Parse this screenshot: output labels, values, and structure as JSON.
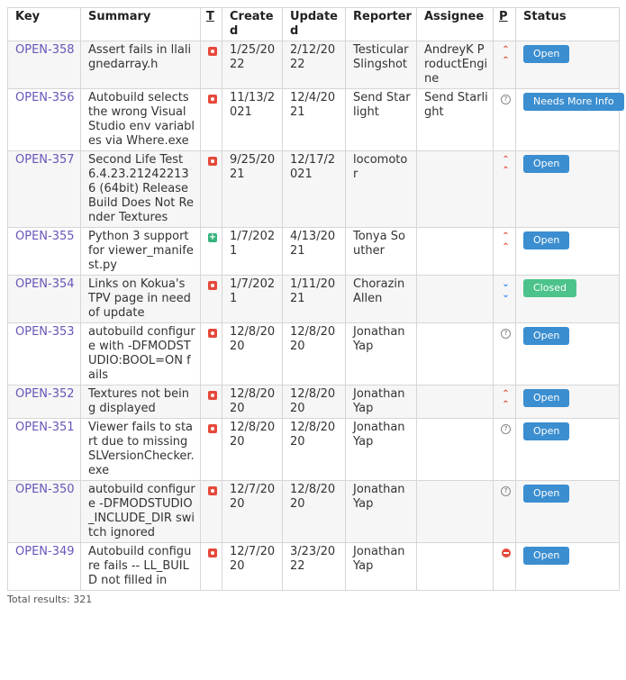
{
  "table": {
    "headers": {
      "key": "Key",
      "summary": "Summary",
      "type": "T",
      "created": "Created",
      "updated": "Updated",
      "reporter": "Reporter",
      "assignee": "Assignee",
      "priority": "P",
      "status": "Status"
    },
    "rows": [
      {
        "key": "OPEN-358",
        "summary": "Assert fails in llalignedarray.h",
        "type": "bug",
        "created": "1/25/2022",
        "updated": "2/12/2022",
        "reporter": "Testicular Slingshot",
        "assignee": "AndreyK ProductEngine",
        "priority": "high",
        "status": "Open"
      },
      {
        "key": "OPEN-356",
        "summary": "Autobuild selects the wrong Visual Studio env variables via Where.exe",
        "type": "bug",
        "created": "11/13/2021",
        "updated": "12/4/2021",
        "reporter": "Send Starlight",
        "assignee": "Send Starlight",
        "priority": "unknown",
        "status": "Needs More Info"
      },
      {
        "key": "OPEN-357",
        "summary": "Second Life Test 6.4.23.212422136 (64bit) Release Build Does Not Render Textures",
        "type": "bug",
        "created": "9/25/2021",
        "updated": "12/17/2021",
        "reporter": "locomotor",
        "assignee": "",
        "priority": "high",
        "status": "Open"
      },
      {
        "key": "OPEN-355",
        "summary": "Python 3 support for viewer_manifest.py",
        "type": "new-feature",
        "created": "1/7/2021",
        "updated": "4/13/2021",
        "reporter": "Tonya Souther",
        "assignee": "",
        "priority": "high",
        "status": "Open"
      },
      {
        "key": "OPEN-354",
        "summary": "Links on Kokua's TPV page in need of update",
        "type": "bug",
        "created": "1/7/2021",
        "updated": "1/11/2021",
        "reporter": "Chorazin Allen",
        "assignee": "",
        "priority": "lowest",
        "status": "Closed"
      },
      {
        "key": "OPEN-353",
        "summary": "autobuild configure with -DFMODSTUDIO:BOOL=ON fails",
        "type": "bug",
        "created": "12/8/2020",
        "updated": "12/8/2020",
        "reporter": "Jonathan Yap",
        "assignee": "",
        "priority": "unknown",
        "status": "Open"
      },
      {
        "key": "OPEN-352",
        "summary": "Textures not being displayed",
        "type": "bug",
        "created": "12/8/2020",
        "updated": "12/8/2020",
        "reporter": "Jonathan Yap",
        "assignee": "",
        "priority": "high",
        "status": "Open"
      },
      {
        "key": "OPEN-351",
        "summary": "Viewer fails to start due to missing SLVersionChecker.exe",
        "type": "bug",
        "created": "12/8/2020",
        "updated": "12/8/2020",
        "reporter": "Jonathan Yap",
        "assignee": "",
        "priority": "unknown",
        "status": "Open"
      },
      {
        "key": "OPEN-350",
        "summary": "autobuild configure -DFMODSTUDIO_INCLUDE_DIR switch ignored",
        "type": "bug",
        "created": "12/7/2020",
        "updated": "12/8/2020",
        "reporter": "Jonathan Yap",
        "assignee": "",
        "priority": "unknown",
        "status": "Open"
      },
      {
        "key": "OPEN-349",
        "summary": "Autobuild configure fails -- LL_BUILD not filled in",
        "type": "bug",
        "created": "12/7/2020",
        "updated": "3/23/2022",
        "reporter": "Jonathan Yap",
        "assignee": "",
        "priority": "blocker",
        "status": "Open"
      }
    ]
  },
  "footer": {
    "total_results": "Total results: 321"
  },
  "colors": {
    "link": "#6a55b8",
    "status_open": "#3b8ed0",
    "status_closed": "#4cc38a",
    "bug_icon": "#e5493a",
    "new_feature_icon": "#36b37e"
  }
}
